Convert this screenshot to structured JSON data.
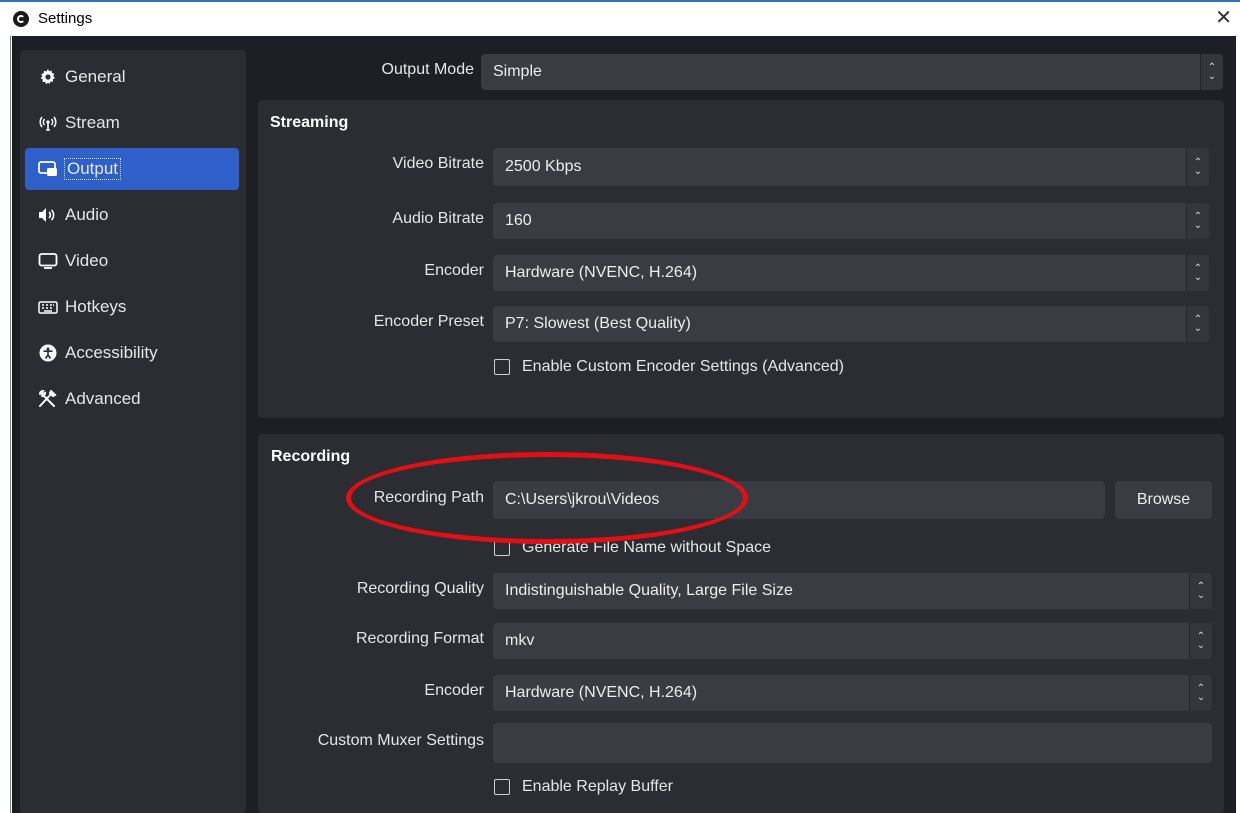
{
  "window": {
    "title": "Settings",
    "close_glyph": "✕"
  },
  "sidebar": {
    "items": [
      {
        "label": "General",
        "icon": "gear-icon"
      },
      {
        "label": "Stream",
        "icon": "broadcast-icon"
      },
      {
        "label": "Output",
        "icon": "output-icon",
        "active": true
      },
      {
        "label": "Audio",
        "icon": "speaker-icon"
      },
      {
        "label": "Video",
        "icon": "monitor-icon"
      },
      {
        "label": "Hotkeys",
        "icon": "keyboard-icon"
      },
      {
        "label": "Accessibility",
        "icon": "accessibility-icon"
      },
      {
        "label": "Advanced",
        "icon": "tools-icon"
      }
    ]
  },
  "output_mode": {
    "label": "Output Mode",
    "value": "Simple"
  },
  "streaming": {
    "title": "Streaming",
    "video_bitrate": {
      "label": "Video Bitrate",
      "value": "2500 Kbps"
    },
    "audio_bitrate": {
      "label": "Audio Bitrate",
      "value": "160"
    },
    "encoder": {
      "label": "Encoder",
      "value": "Hardware (NVENC, H.264)"
    },
    "encoder_preset": {
      "label": "Encoder Preset",
      "value": "P7: Slowest (Best Quality)"
    },
    "custom_encoder": {
      "label": "Enable Custom Encoder Settings (Advanced)",
      "checked": false
    }
  },
  "recording": {
    "title": "Recording",
    "path": {
      "label": "Recording Path",
      "value": "C:\\Users\\jkrou\\Videos",
      "browse_label": "Browse"
    },
    "gen_filename": {
      "label": "Generate File Name without Space",
      "checked": false
    },
    "quality": {
      "label": "Recording Quality",
      "value": "Indistinguishable Quality, Large File Size"
    },
    "format": {
      "label": "Recording Format",
      "value": "mkv"
    },
    "encoder": {
      "label": "Encoder",
      "value": "Hardware (NVENC, H.264)"
    },
    "muxer": {
      "label": "Custom Muxer Settings",
      "value": ""
    },
    "replay_buffer": {
      "label": "Enable Replay Buffer",
      "checked": false
    }
  },
  "colors": {
    "accent": "#2f5fc8",
    "annotation": "#e20f15"
  }
}
